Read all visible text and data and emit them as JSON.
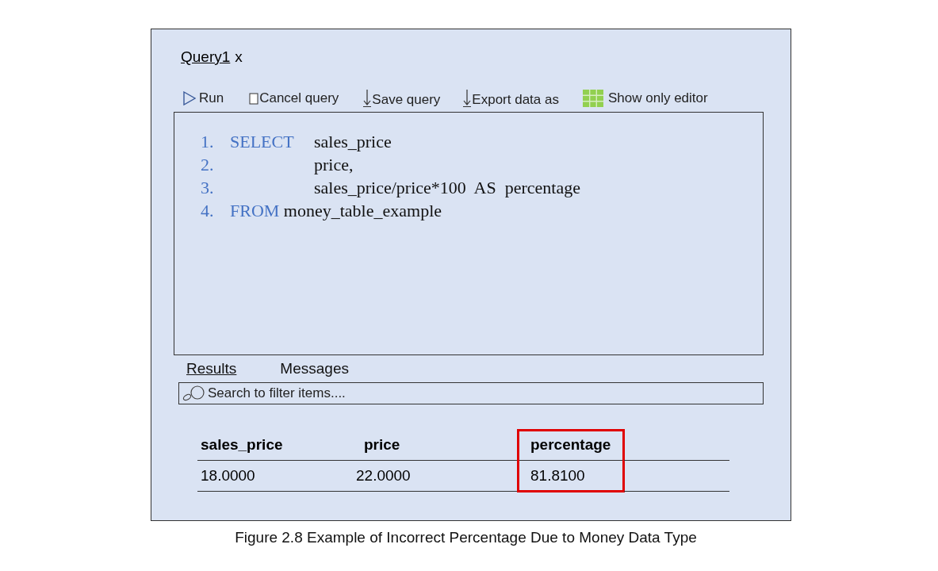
{
  "tab": {
    "label": "Query1",
    "close": "x"
  },
  "toolbar": [
    {
      "kind": "run",
      "label": "Run"
    },
    {
      "kind": "cancel",
      "label": "Cancel query"
    },
    {
      "kind": "save",
      "label": "Save query"
    },
    {
      "kind": "export",
      "label": "Export data as"
    },
    {
      "kind": "editor",
      "label": "Show only editor"
    }
  ],
  "editor": {
    "lines": [
      {
        "kind": "aligned",
        "number": "1.",
        "keyword": "SELECT",
        "code": "sales_price"
      },
      {
        "kind": "aligned",
        "number": "2.",
        "code": "price,"
      },
      {
        "kind": "aligned",
        "number": "3.",
        "code": "sales_price/price*100  AS  percentage"
      },
      {
        "kind": "inline",
        "number": "4.",
        "keyword": "FROM",
        "code": "money_table_example"
      }
    ]
  },
  "result_tabs": [
    {
      "label": "Results",
      "selected": true
    },
    {
      "label": "Messages",
      "selected": false
    }
  ],
  "search": {
    "placeholder": "Search to filter items...."
  },
  "results": {
    "columns": [
      {
        "label": "sales_price",
        "highlighted": false
      },
      {
        "label": "price",
        "highlighted": false
      },
      {
        "label": "percentage",
        "highlighted": true
      }
    ],
    "rows": [
      [
        "18.0000",
        "22.0000",
        "81.8100"
      ]
    ]
  },
  "caption": "Figure 2.8 Example of Incorrect Percentage Due to Money Data Type"
}
